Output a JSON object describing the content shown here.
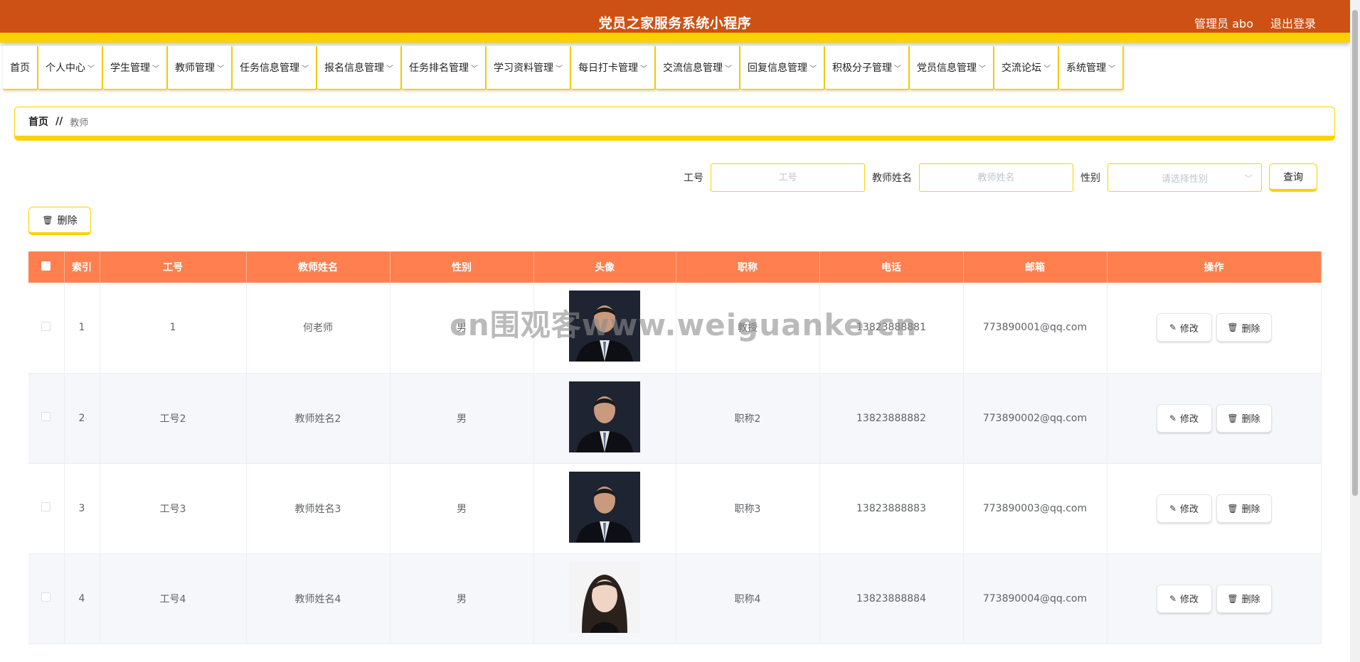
{
  "header": {
    "title": "党员之家服务系统小程序",
    "user": "管理员 abo",
    "logout": "退出登录"
  },
  "nav": [
    {
      "label": "首页",
      "dropdown": false
    },
    {
      "label": "个人中心",
      "dropdown": true
    },
    {
      "label": "学生管理",
      "dropdown": true
    },
    {
      "label": "教师管理",
      "dropdown": true
    },
    {
      "label": "任务信息管理",
      "dropdown": true
    },
    {
      "label": "报名信息管理",
      "dropdown": true
    },
    {
      "label": "任务排名管理",
      "dropdown": true
    },
    {
      "label": "学习资料管理",
      "dropdown": true
    },
    {
      "label": "每日打卡管理",
      "dropdown": true
    },
    {
      "label": "交流信息管理",
      "dropdown": true
    },
    {
      "label": "回复信息管理",
      "dropdown": true
    },
    {
      "label": "积极分子管理",
      "dropdown": true
    },
    {
      "label": "党员信息管理",
      "dropdown": true
    },
    {
      "label": "交流论坛",
      "dropdown": true
    },
    {
      "label": "系统管理",
      "dropdown": true
    }
  ],
  "breadcrumb": {
    "home": "首页",
    "separator": "//",
    "current": "教师"
  },
  "search": {
    "id_label": "工号",
    "id_placeholder": "工号",
    "name_label": "教师姓名",
    "name_placeholder": "教师姓名",
    "gender_label": "性别",
    "gender_placeholder": "请选择性别",
    "query_button": "查询"
  },
  "toolbar": {
    "delete_button": "删除"
  },
  "table": {
    "columns": [
      "索引",
      "工号",
      "教师姓名",
      "性别",
      "头像",
      "职称",
      "电话",
      "邮箱",
      "操作"
    ],
    "rows": [
      {
        "index": "1",
        "id": "1",
        "name": "何老师",
        "gender": "男",
        "avatar": "male",
        "title": "教授",
        "phone": "13823888881",
        "email": "773890001@qq.com"
      },
      {
        "index": "2",
        "id": "工号2",
        "name": "教师姓名2",
        "gender": "男",
        "avatar": "male",
        "title": "职称2",
        "phone": "13823888882",
        "email": "773890002@qq.com"
      },
      {
        "index": "3",
        "id": "工号3",
        "name": "教师姓名3",
        "gender": "男",
        "avatar": "male",
        "title": "职称3",
        "phone": "13823888883",
        "email": "773890003@qq.com"
      },
      {
        "index": "4",
        "id": "工号4",
        "name": "教师姓名4",
        "gender": "男",
        "avatar": "female",
        "title": "职称4",
        "phone": "13823888884",
        "email": "773890004@qq.com"
      }
    ],
    "edit_label": "修改",
    "delete_label": "删除"
  },
  "watermark": "cn围观客www.weiguanke.cn",
  "colors": {
    "header_bg": "#cd5114",
    "accent": "#fcd100",
    "table_head": "#ff7f4f"
  }
}
